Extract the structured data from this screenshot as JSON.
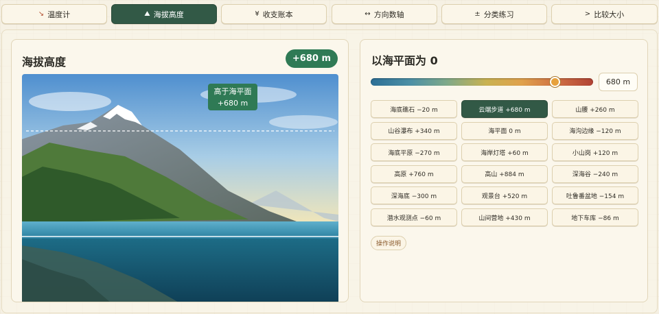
{
  "tabs": [
    {
      "icon": "↘",
      "label": "温度计"
    },
    {
      "icon": "⛰",
      "label": "海拔高度"
    },
    {
      "icon": "¥",
      "label": "收支账本"
    },
    {
      "icon": "↔",
      "label": "方向数轴"
    },
    {
      "icon": "±",
      "label": "分类练习"
    },
    {
      "icon": ">",
      "label": "比较大小"
    }
  ],
  "active_tab": "海拔高度",
  "left_panel": {
    "title": "海拔高度",
    "badge": "+680 m",
    "callout_line1": "高于海平面",
    "callout_line2": "+680 m",
    "scene_icon": "mountain-lake-scene"
  },
  "right_panel": {
    "title": "以海平面为 0",
    "slider_value": 680,
    "slider_min": -300,
    "slider_max": 884,
    "value_text": "680 m",
    "locations": [
      "海底礁石 −20 m",
      "云端步道 +680 m",
      "山腰 +260 m",
      "山谷瀑布 +340 m",
      "海平面 0 m",
      "海沟边缘 −120 m",
      "海底平原 −270 m",
      "海岸灯塔 +60 m",
      "小山岗 +120 m",
      "高原 +760 m",
      "高山 +884 m",
      "深海谷 −240 m",
      "深海底 −300 m",
      "观景台 +520 m",
      "吐鲁番盆地 −154 m",
      "潜水观测点 −60 m",
      "山间营地 +430 m",
      "地下车库 −86 m"
    ],
    "active_location": "云端步道 +680 m",
    "help_label": "操作说明"
  },
  "colors": {
    "accent_green": "#325946",
    "badge_green": "#2f7a55",
    "page_bg": "#f6f1e4"
  }
}
